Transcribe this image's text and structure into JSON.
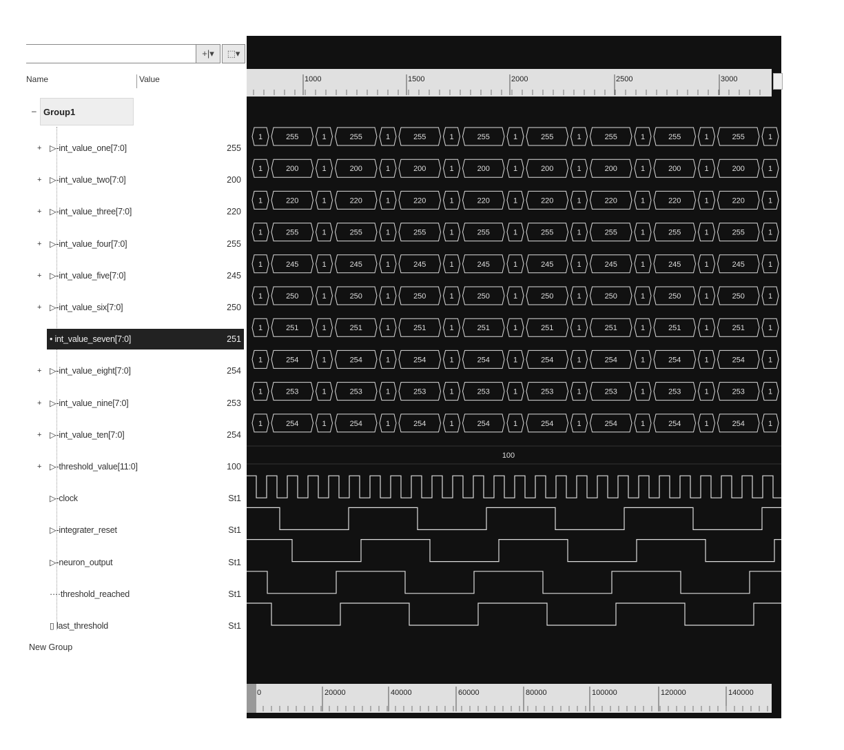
{
  "toolbar": {
    "dropdown_arrow": "▾",
    "btn1_label": "+|▾",
    "btn2_label": "⬚▾"
  },
  "tree": {
    "col_name": "Name",
    "col_value": "Value",
    "group_label": "Group1",
    "new_group_label": "New Group",
    "signals": [
      {
        "name": "int_value_one[7:0]",
        "value": "255"
      },
      {
        "name": "int_value_two[7:0]",
        "value": "200"
      },
      {
        "name": "int_value_three[7:0]",
        "value": "220"
      },
      {
        "name": "int_value_four[7:0]",
        "value": "255"
      },
      {
        "name": "int_value_five[7:0]",
        "value": "245"
      },
      {
        "name": "int_value_six[7:0]",
        "value": "250"
      },
      {
        "name": "int_value_seven[7:0]",
        "value": "251"
      },
      {
        "name": "int_value_eight[7:0]",
        "value": "254"
      },
      {
        "name": "int_value_nine[7:0]",
        "value": "253"
      },
      {
        "name": "int_value_ten[7:0]",
        "value": "254"
      },
      {
        "name": "threshold_value[11:0]",
        "value": "100"
      },
      {
        "name": "clock",
        "value": "St1"
      },
      {
        "name": "integrater_reset",
        "value": "St1"
      },
      {
        "name": "neuron_output",
        "value": "St1"
      },
      {
        "name": "threshold_reached",
        "value": "St1"
      },
      {
        "name": "last_threshold",
        "value": "St1"
      }
    ]
  },
  "waveform": {
    "top_ruler_ticks": [
      "1000",
      "1500",
      "2000",
      "2500",
      "3000"
    ],
    "bottom_ruler_ticks": [
      "0",
      "20000",
      "40000",
      "60000",
      "80000",
      "100000",
      "120000",
      "140000"
    ],
    "bus_low_value": "1",
    "threshold_bus_value": "100",
    "colors": {
      "background": "#111111",
      "trace": "#dddddd"
    }
  }
}
